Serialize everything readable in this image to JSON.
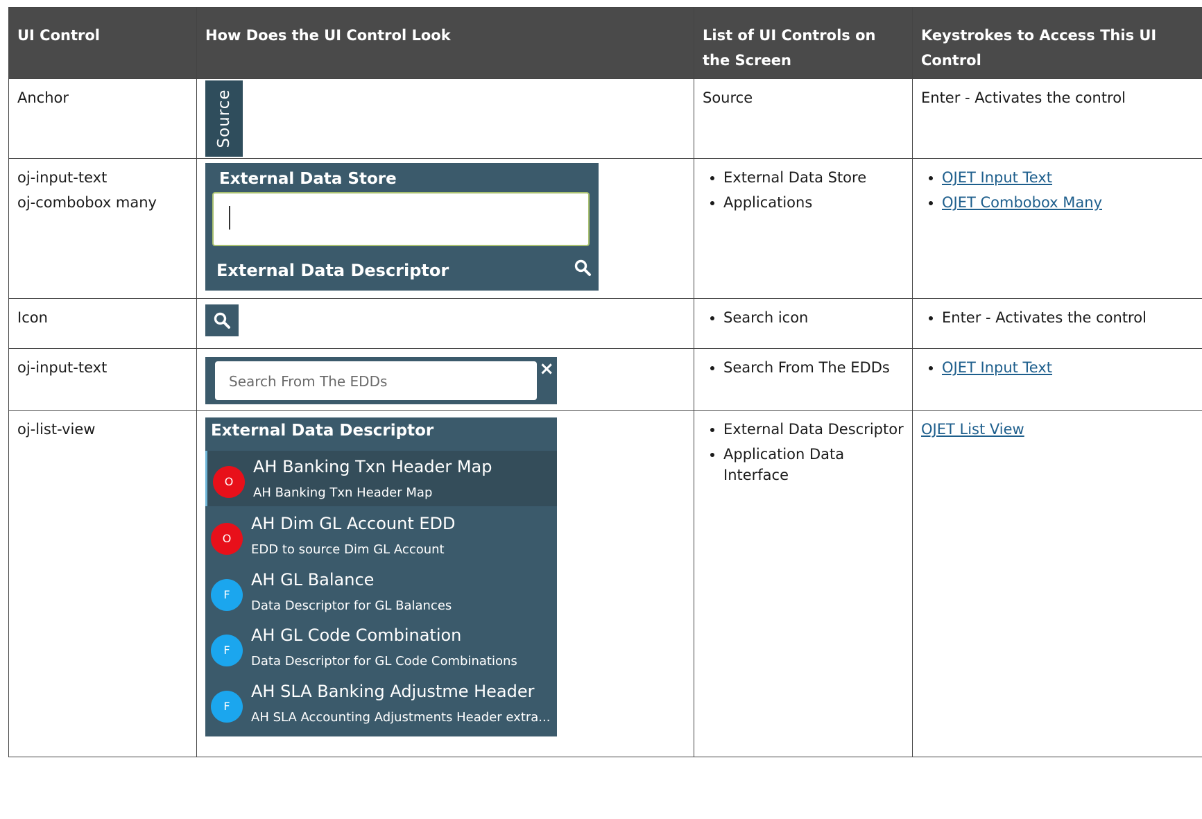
{
  "headers": [
    "UI Control",
    "How Does the UI Control Look",
    "List of UI Controls on the Screen",
    "Keystrokes to Access This UI Control"
  ],
  "rows": {
    "anchor": {
      "control": "Anchor",
      "visual_label": "Source",
      "list": "Source",
      "keystroke": "Enter - Activates the control"
    },
    "input_combobox": {
      "control_1": "oj-input-text",
      "control_2": "oj-combobox many",
      "visual_title": "External Data Store",
      "visual_subtitle": "External Data Descriptor",
      "list": [
        "External Data Store",
        "Applications"
      ],
      "links": [
        "OJET Input Text",
        "OJET Combobox Many"
      ]
    },
    "icon": {
      "control": "Icon",
      "list": [
        "Search icon"
      ],
      "keystroke": [
        "Enter - Activates the control"
      ]
    },
    "input_text": {
      "control": "oj-input-text",
      "placeholder": "Search From The EDDs",
      "clear_glyph": "×",
      "list": [
        "Search From The EDDs"
      ],
      "links": [
        "OJET Input Text"
      ]
    },
    "list_view": {
      "control": "oj-list-view",
      "header": "External Data Descriptor",
      "items": [
        {
          "badge": "O",
          "title": "AH Banking Txn Header Map",
          "subtitle": "AH Banking Txn Header Map"
        },
        {
          "badge": "O",
          "title": "AH Dim GL Account EDD",
          "subtitle": "EDD to source Dim GL Account"
        },
        {
          "badge": "F",
          "title": "AH GL Balance",
          "subtitle": "Data Descriptor for GL Balances"
        },
        {
          "badge": "F",
          "title": "AH GL Code Combination",
          "subtitle": "Data Descriptor for GL Code Combinations"
        },
        {
          "badge": "F",
          "title": "AH SLA Banking Adjustme Header",
          "subtitle": "AH SLA Accounting Adjustments Header extra..."
        }
      ],
      "list": [
        "External Data Descriptor",
        "Application Data Interface"
      ],
      "link": "OJET List View"
    }
  },
  "colors": {
    "panel": "#3b5a6b",
    "header_bg": "#4a4a4a",
    "badge_o": "#e8101a",
    "badge_f": "#1ba6ee",
    "link": "#1d5e8c"
  }
}
